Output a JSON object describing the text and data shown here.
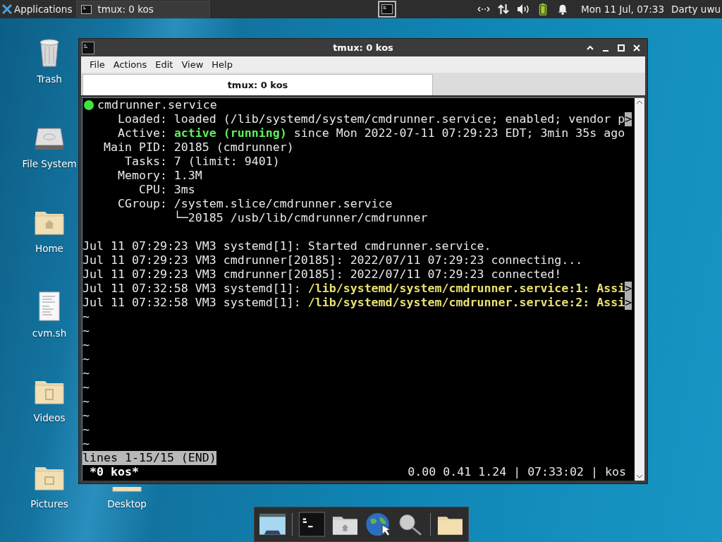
{
  "panel": {
    "apps_menu": "Applications",
    "task": {
      "label": "tmux: 0 kos",
      "selected": false
    },
    "clock": "Mon 11 Jul, 07:33",
    "user": "Darty uwu"
  },
  "desktop_icons": [
    {
      "label": "Trash",
      "kind": "trash"
    },
    {
      "label": "File System",
      "kind": "drive"
    },
    {
      "label": "Home",
      "kind": "home"
    },
    {
      "label": "cvm.sh",
      "kind": "script"
    },
    {
      "label": "Videos",
      "kind": "videos"
    },
    {
      "label": "Pictures",
      "kind": "pictures"
    },
    {
      "label": "Desktop",
      "kind": "desktop"
    }
  ],
  "window": {
    "title": "tmux: 0 kos",
    "menu": [
      "File",
      "Actions",
      "Edit",
      "View",
      "Help"
    ],
    "tabs": [
      {
        "label": "tmux: 0 kos",
        "selected": true
      }
    ],
    "terminal": {
      "lines": [
        {
          "kind": "unit",
          "running": true,
          "segments": [
            {
              "text": "cmdrunner.service",
              "kind": "plain"
            }
          ]
        },
        {
          "kind": "text",
          "segments": [
            {
              "text": "     Loaded: loaded (/lib/systemd/system/cmdrunner.service; enabled; vendor p",
              "kind": "plain"
            }
          ],
          "overflow": ">"
        },
        {
          "kind": "text",
          "segments": [
            {
              "text": "     Active: ",
              "kind": "plain"
            },
            {
              "text": "active (running)",
              "kind": "green"
            },
            {
              "text": " since Mon 2022-07-11 07:29:23 EDT; 3min 35s ago",
              "kind": "plain"
            }
          ]
        },
        {
          "kind": "text",
          "segments": [
            {
              "text": "   Main PID: 20185 (cmdrunner)",
              "kind": "plain"
            }
          ]
        },
        {
          "kind": "text",
          "segments": [
            {
              "text": "      Tasks: 7 (limit: 9401)",
              "kind": "plain"
            }
          ]
        },
        {
          "kind": "text",
          "segments": [
            {
              "text": "     Memory: 1.3M",
              "kind": "plain"
            }
          ]
        },
        {
          "kind": "text",
          "segments": [
            {
              "text": "        CPU: 3ms",
              "kind": "plain"
            }
          ]
        },
        {
          "kind": "text",
          "segments": [
            {
              "text": "     CGroup: /system.slice/cmdrunner.service",
              "kind": "plain"
            }
          ]
        },
        {
          "kind": "text",
          "segments": [
            {
              "text": "             └─20185 /usb/lib/cmdrunner/cmdrunner",
              "kind": "plain"
            }
          ]
        },
        {
          "kind": "blank"
        },
        {
          "kind": "text",
          "segments": [
            {
              "text": "Jul 11 07:29:23 VM3 systemd[1]: Started cmdrunner.service.",
              "kind": "plain"
            }
          ]
        },
        {
          "kind": "text",
          "segments": [
            {
              "text": "Jul 11 07:29:23 VM3 cmdrunner[20185]: 2022/07/11 07:29:23 connecting...",
              "kind": "plain"
            }
          ]
        },
        {
          "kind": "text",
          "segments": [
            {
              "text": "Jul 11 07:29:23 VM3 cmdrunner[20185]: 2022/07/11 07:29:23 connected!",
              "kind": "plain"
            }
          ]
        },
        {
          "kind": "text",
          "segments": [
            {
              "text": "Jul 11 07:32:58 VM3 systemd[1]: ",
              "kind": "plain"
            },
            {
              "text": "/lib/systemd/system/cmdrunner.service:1: Assi",
              "kind": "yellow"
            }
          ],
          "overflow": ">"
        },
        {
          "kind": "text",
          "segments": [
            {
              "text": "Jul 11 07:32:58 VM3 systemd[1]: ",
              "kind": "plain"
            },
            {
              "text": "/lib/systemd/system/cmdrunner.service:2: Assi",
              "kind": "yellow"
            }
          ],
          "overflow": ">"
        }
      ],
      "tildes": [
        "~",
        "~",
        "~",
        "~",
        "~",
        "~",
        "~",
        "~",
        "~",
        "~"
      ],
      "pager_status": "lines 1-15/15 (END)",
      "tmux_status": {
        "window": "*0 kos*",
        "right": "0.00 0.41 1.24 | 07:33:02 | kos"
      }
    }
  }
}
